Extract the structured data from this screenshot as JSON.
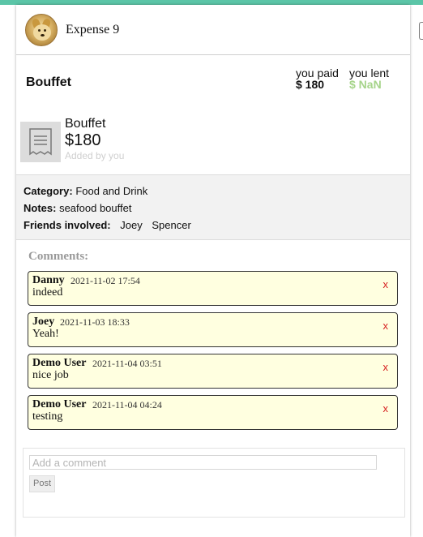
{
  "header": {
    "title": "Expense 9"
  },
  "summary": {
    "name": "Bouffet",
    "paid_label": "you paid",
    "paid_value": "$ 180",
    "lent_label": "you lent",
    "lent_value": "$ NaN",
    "lent_color": "#a6d48a"
  },
  "detail": {
    "name": "Bouffet",
    "amount": "$180",
    "added_by": "Added by you",
    "icon": "receipt-icon"
  },
  "meta": {
    "category_label": "Category:",
    "category_value": "Food and Drink",
    "notes_label": "Notes:",
    "notes_value": "seafood bouffet",
    "friends_label": "Friends involved:",
    "friends": [
      "Joey",
      "Spencer"
    ]
  },
  "comments": {
    "heading": "Comments:",
    "delete_label": "x",
    "items": [
      {
        "author": "Danny",
        "time": "2021-11-02  17:54",
        "text": "indeed"
      },
      {
        "author": "Joey",
        "time": "2021-11-03  18:33",
        "text": "Yeah!"
      },
      {
        "author": "Demo User",
        "time": "2021-11-04  03:51",
        "text": "nice job"
      },
      {
        "author": "Demo User",
        "time": "2021-11-04  04:24",
        "text": "testing"
      }
    ]
  },
  "form": {
    "placeholder": "Add a comment",
    "value": "",
    "post_label": "Post"
  },
  "colors": {
    "accent": "#5bc5a7",
    "comment_bg": "#ffffe0",
    "delete": "#d62020"
  }
}
